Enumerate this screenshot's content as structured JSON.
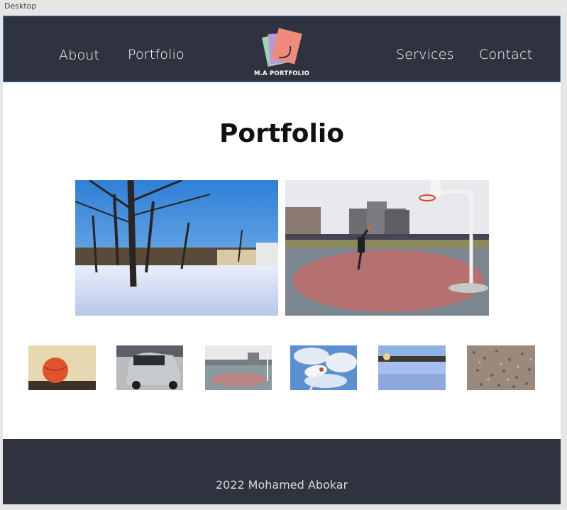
{
  "window": {
    "title": "Desktop"
  },
  "nav": {
    "about": "About",
    "portfolio": "Portfolio",
    "services": "Services",
    "contact": "Contact",
    "logo_text": "M.A PORTFOLIO"
  },
  "main": {
    "title": "Portfolio",
    "featured_photos": [
      "snowy-park-trees-photo",
      "basketball-court-player-photo"
    ],
    "thumbnails": [
      "basketball-closeup-thumb",
      "silver-suv-thumb",
      "basketball-court-thumb",
      "basketball-hoop-sky-thumb",
      "frozen-field-sunset-thumb",
      "gravel-ground-thumb"
    ]
  },
  "footer": {
    "text": "2022 Mohamed Abokar"
  },
  "colors": {
    "nav_bg": "#2f333f",
    "footer_bg": "#2f333f",
    "nav_border": "#4a7fc4",
    "page_bg": "#ffffff"
  }
}
